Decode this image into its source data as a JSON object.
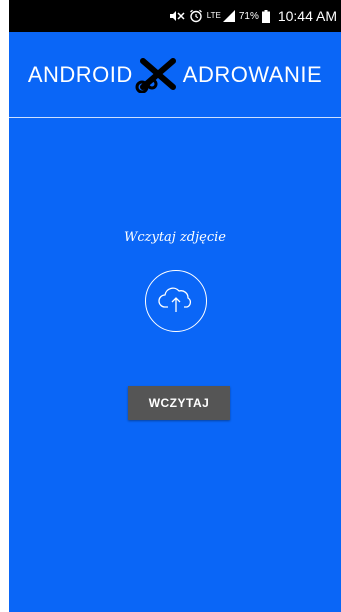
{
  "status_bar": {
    "network_label": "LTE",
    "battery_percent": "71%",
    "time": "10:44 AM",
    "icons": [
      "mute-icon",
      "alarm-icon",
      "signal-icon",
      "battery-icon"
    ]
  },
  "header": {
    "title_left": "ANDROID",
    "title_right": "ADROWANIE",
    "logo_icon": "scissors-icon"
  },
  "main": {
    "prompt": "Wczytaj zdjęcie",
    "upload_icon": "cloud-upload-icon",
    "button_label": "WCZYTAJ"
  },
  "colors": {
    "background": "#0a66f7",
    "button": "#555555",
    "text": "#ffffff"
  }
}
